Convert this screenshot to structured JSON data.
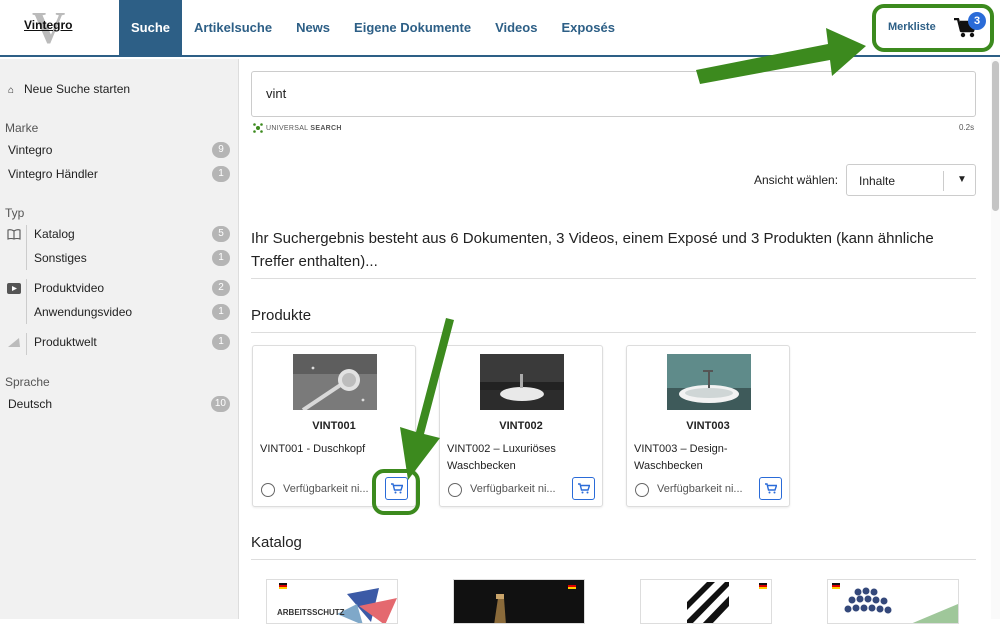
{
  "brand": {
    "name": "Vintegro",
    "mark": "V"
  },
  "nav": {
    "tabs": [
      "Suche",
      "Artikelsuche",
      "News",
      "Eigene Dokumente",
      "Videos",
      "Exposés"
    ],
    "active": "Suche"
  },
  "merkliste": {
    "label": "Merkliste",
    "count": "3"
  },
  "sidebar": {
    "new_search": "Neue Suche starten",
    "marke": {
      "heading": "Marke",
      "items": [
        {
          "label": "Vintegro",
          "count": "9"
        },
        {
          "label": "Vintegro Händler",
          "count": "1"
        }
      ]
    },
    "typ": {
      "heading": "Typ",
      "items": [
        {
          "label": "Katalog",
          "count": "5"
        },
        {
          "label": "Sonstiges",
          "count": "1"
        },
        {
          "label": "Produktvideo",
          "count": "2"
        },
        {
          "label": "Anwendungsvideo",
          "count": "1"
        },
        {
          "label": "Produktwelt",
          "count": "1"
        }
      ]
    },
    "sprache": {
      "heading": "Sprache",
      "items": [
        {
          "label": "Deutsch",
          "count": "10"
        }
      ]
    }
  },
  "search": {
    "value": "vint",
    "brand_prefix": "UNIVERSAL",
    "brand_suffix": "SEARCH",
    "time": "0.2s"
  },
  "view": {
    "label": "Ansicht wählen:",
    "selected": "Inhalte"
  },
  "result_text": "Ihr Suchergebnis besteht aus 6 Dokumenten, 3 Videos, einem Exposé und 3 Produkten (kann ähnliche Treffer enthalten)...",
  "sections": {
    "products": "Produkte",
    "catalog": "Katalog"
  },
  "products": [
    {
      "code": "VINT001",
      "desc": "VINT001 - Duschkopf",
      "avail": "Verfügbarkeit ni..."
    },
    {
      "code": "VINT002",
      "desc": "VINT002 – Luxuriöses Waschbecken",
      "avail": "Verfügbarkeit ni..."
    },
    {
      "code": "VINT003",
      "desc": "VINT003 – Design-Waschbecken",
      "avail": "Verfügbarkeit ni..."
    }
  ],
  "catalog_cards": [
    {
      "title": "ARBEITSSCHUTZ"
    }
  ],
  "colors": {
    "accent": "#2d5f86",
    "highlight": "#3c8a1e",
    "button": "#2a6bd8"
  }
}
